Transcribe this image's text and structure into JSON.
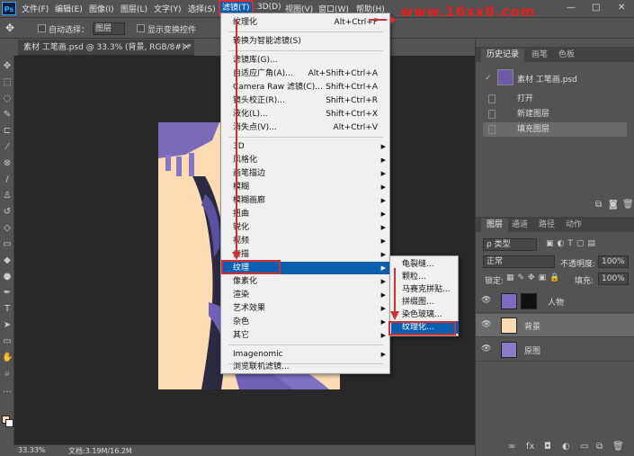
{
  "menubar": {
    "logo": "Ps",
    "items": [
      "文件(F)",
      "编辑(E)",
      "图像(I)",
      "图层(L)",
      "文字(Y)",
      "选择(S)",
      "滤镜(T)",
      "3D(D)",
      "视图(V)",
      "窗口(W)",
      "帮助(H)"
    ],
    "active_index": 6,
    "window_controls": [
      "—",
      "□",
      "✕"
    ]
  },
  "watermark": "www.16xx8.com",
  "options": {
    "auto_select_label": "自动选择：",
    "auto_select_value": "图层",
    "show_transform_label": "显示变换控件"
  },
  "document": {
    "tab_label": "素材 工笔画.psd @ 33.3% (背景, RGB/8#) *",
    "close": "✕"
  },
  "filter_menu": {
    "items": [
      {
        "label": "纹理化",
        "shortcut": "Alt+Ctrl+F"
      },
      {
        "label": "转换为智能滤镜(S)",
        "shortcut": ""
      },
      {
        "label": "滤镜库(G)...",
        "shortcut": ""
      },
      {
        "label": "自适应广角(A)...",
        "shortcut": "Alt+Shift+Ctrl+A"
      },
      {
        "label": "Camera Raw 滤镜(C)...",
        "shortcut": "Shift+Ctrl+A"
      },
      {
        "label": "镜头校正(R)...",
        "shortcut": "Shift+Ctrl+R"
      },
      {
        "label": "液化(L)...",
        "shortcut": "Shift+Ctrl+X"
      },
      {
        "label": "消失点(V)...",
        "shortcut": "Alt+Ctrl+V"
      },
      {
        "label": "3D",
        "shortcut": ""
      },
      {
        "label": "风格化",
        "shortcut": ""
      },
      {
        "label": "画笔描边",
        "shortcut": ""
      },
      {
        "label": "模糊",
        "shortcut": ""
      },
      {
        "label": "模糊画廊",
        "shortcut": ""
      },
      {
        "label": "扭曲",
        "shortcut": ""
      },
      {
        "label": "锐化",
        "shortcut": ""
      },
      {
        "label": "视频",
        "shortcut": ""
      },
      {
        "label": "素描",
        "shortcut": ""
      },
      {
        "label": "纹理",
        "shortcut": ""
      },
      {
        "label": "像素化",
        "shortcut": ""
      },
      {
        "label": "渲染",
        "shortcut": ""
      },
      {
        "label": "艺术效果",
        "shortcut": ""
      },
      {
        "label": "杂色",
        "shortcut": ""
      },
      {
        "label": "其它",
        "shortcut": ""
      },
      {
        "label": "Imagenomic",
        "shortcut": ""
      },
      {
        "label": "浏览联机滤镜...",
        "shortcut": ""
      }
    ],
    "submenu_arrow": "▶",
    "highlighted_index": 17
  },
  "texture_submenu": {
    "items": [
      "龟裂缝...",
      "颗粒...",
      "马赛克拼贴...",
      "拼缀图...",
      "染色玻璃...",
      "纹理化..."
    ],
    "highlighted_index": 5
  },
  "history_panel": {
    "tabs": [
      "历史记录",
      "画笔",
      "色板"
    ],
    "snapshot_label": "素材 工笔画.psd",
    "states": [
      "打开",
      "新建图层",
      "填充图层"
    ],
    "selected_index": 2
  },
  "layers_panel": {
    "tabs": [
      "图层",
      "通道",
      "路径",
      "动作"
    ],
    "filter_type": "ρ 类型",
    "blend_mode": "正常",
    "opacity_label": "不透明度:",
    "opacity_value": "100%",
    "lock_label": "锁定:",
    "fill_label": "填充:",
    "fill_value": "100%",
    "layers": [
      {
        "name": "人物",
        "selected": false
      },
      {
        "name": "背景",
        "selected": true
      },
      {
        "name": "原图",
        "selected": false
      }
    ],
    "eye": "👁"
  },
  "status": {
    "zoom": "33.33%",
    "doc_info": "文档:3.19M/16.2M"
  },
  "colors": {
    "accent": "#0a5fb0",
    "annotation_red": "#d32f2f",
    "canvas_bg": "#fddcb4"
  }
}
